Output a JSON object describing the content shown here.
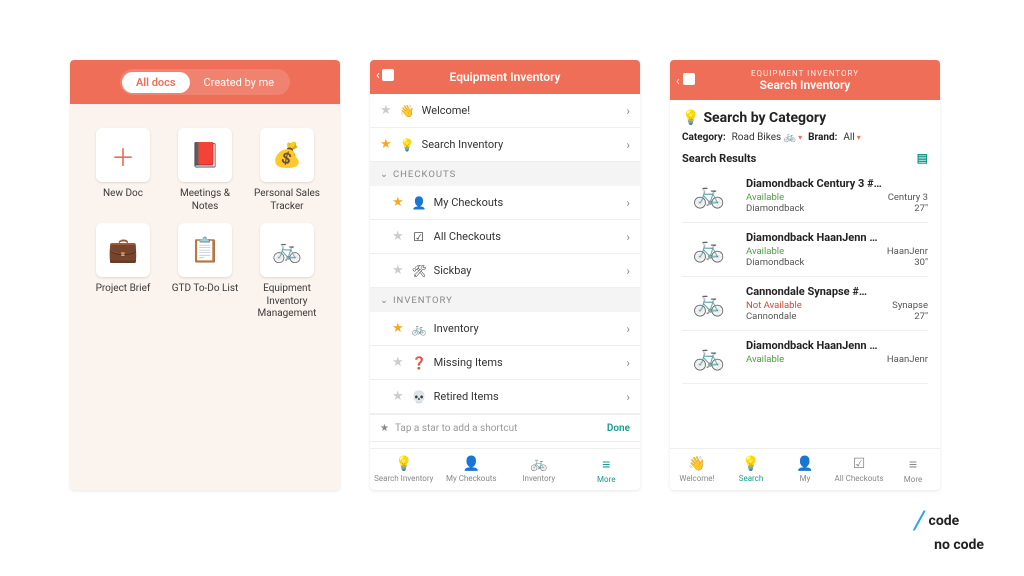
{
  "brand": {
    "line1": "code",
    "line2": "no code"
  },
  "phone1": {
    "segments": {
      "all": "All docs",
      "mine": "Created by me"
    },
    "tiles": [
      {
        "label": "New Doc",
        "icon": "＋",
        "name": "tile-new-doc"
      },
      {
        "label": "Meetings & Notes",
        "icon": "📕",
        "name": "tile-meetings"
      },
      {
        "label": "Personal Sales Tracker",
        "icon": "💰",
        "name": "tile-sales"
      },
      {
        "label": "Project Brief",
        "icon": "💼",
        "name": "tile-project-brief"
      },
      {
        "label": "GTD To-Do List",
        "icon": "📋",
        "name": "tile-gtd"
      },
      {
        "label": "Equipment Inventory Management",
        "icon": "🚲",
        "name": "tile-equip"
      }
    ]
  },
  "phone2": {
    "title": "Equipment Inventory",
    "top_rows": [
      {
        "label": "Welcome!",
        "icon": "👋",
        "star": false
      },
      {
        "label": "Search Inventory",
        "icon": "💡",
        "star": true
      }
    ],
    "sections": [
      {
        "header": "CHECKOUTS",
        "rows": [
          {
            "label": "My Checkouts",
            "icon": "👤",
            "star": true
          },
          {
            "label": "All Checkouts",
            "icon": "☑",
            "star": false
          },
          {
            "label": "Sickbay",
            "icon": "🛠",
            "star": false
          }
        ]
      },
      {
        "header": "INVENTORY",
        "rows": [
          {
            "label": "Inventory",
            "icon": "🚲",
            "star": true
          },
          {
            "label": "Missing Items",
            "icon": "❓",
            "star": false
          },
          {
            "label": "Retired Items",
            "icon": "💀",
            "star": false
          }
        ]
      }
    ],
    "hint": "Tap a star to add a shortcut",
    "done": "Done",
    "tabs": [
      {
        "label": "Search Inventory",
        "icon": "💡"
      },
      {
        "label": "My Checkouts",
        "icon": "👤"
      },
      {
        "label": "Inventory",
        "icon": "🚲"
      },
      {
        "label": "More",
        "icon": "≡",
        "active": true
      }
    ]
  },
  "phone3": {
    "crumb": "EQUIPMENT INVENTORY",
    "title": "Search Inventory",
    "heading": "Search by Category",
    "filters": {
      "cat_label": "Category:",
      "cat_value": "Road Bikes 🚲",
      "brand_label": "Brand:",
      "brand_value": "All"
    },
    "results_header": "Search Results",
    "results": [
      {
        "name": "Diamondback Century 3 #…",
        "status": "Available",
        "status_ok": true,
        "model": "Century 3",
        "brand": "Diamondback",
        "size": "27\""
      },
      {
        "name": "Diamondback HaanJenn …",
        "status": "Available",
        "status_ok": true,
        "model": "HaanJenr",
        "brand": "Diamondback",
        "size": "30\""
      },
      {
        "name": "Cannondale Synapse #…",
        "status": "Not Available",
        "status_ok": false,
        "model": "Synapse",
        "brand": "Cannondale",
        "size": "27\"",
        "avatar": true
      },
      {
        "name": "Diamondback HaanJenn …",
        "status": "Available",
        "status_ok": true,
        "model": "HaanJenr",
        "brand": "",
        "size": ""
      }
    ],
    "tabs": [
      {
        "label": "Welcome!",
        "icon": "👋"
      },
      {
        "label": "Search",
        "icon": "💡",
        "active": true
      },
      {
        "label": "My",
        "icon": "👤"
      },
      {
        "label": "All Checkouts",
        "icon": "☑"
      },
      {
        "label": "More",
        "icon": "≡"
      }
    ]
  }
}
